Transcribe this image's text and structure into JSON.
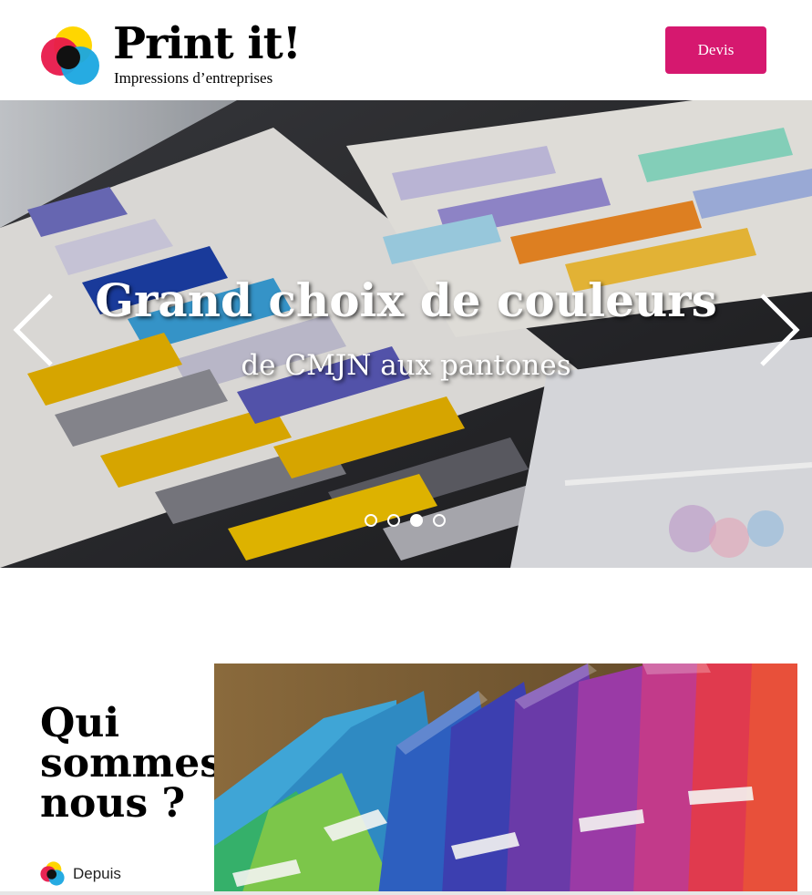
{
  "header": {
    "logo_title": "Print it!",
    "logo_subtitle": "Impressions d’entreprises",
    "devis_label": "Devis"
  },
  "hero": {
    "title": "Grand choix de couleurs",
    "subtitle": "de CMJN aux pantones",
    "prev_icon": "chevron-left-icon",
    "next_icon": "chevron-right-icon",
    "slide_count": 4,
    "active_slide": 3
  },
  "about": {
    "title_lines": [
      "Qui",
      "sommes-",
      "nous ?"
    ],
    "intro_text": "Depuis"
  },
  "colors": {
    "accent": "#d6186f",
    "logo_yellow": "#ffd600",
    "logo_red": "#e8194b",
    "logo_blue": "#1aa6e0",
    "logo_dark": "#111111"
  }
}
